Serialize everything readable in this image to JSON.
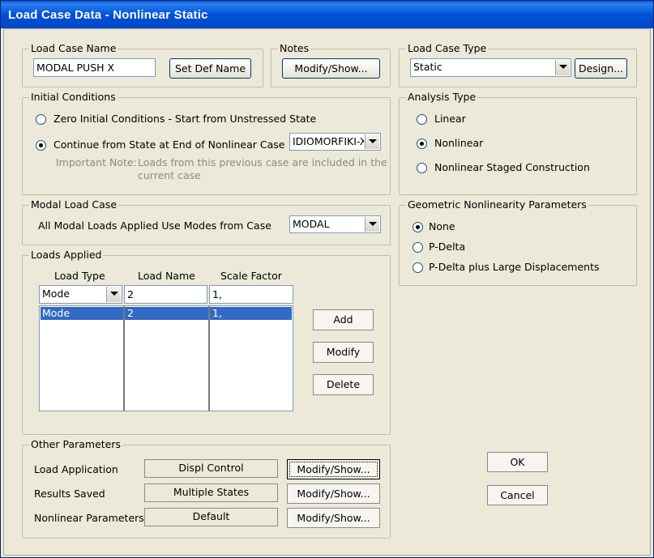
{
  "window": {
    "title": "Load Case Data - Nonlinear Static"
  },
  "load_case_name": {
    "legend": "Load Case Name",
    "value": "MODAL PUSH X",
    "set_def_name_label": "Set Def Name"
  },
  "notes": {
    "legend": "Notes",
    "modify_show_label": "Modify/Show..."
  },
  "load_case_type": {
    "legend": "Load Case Type",
    "selected": "Static",
    "design_label": "Design..."
  },
  "initial_conditions": {
    "legend": "Initial Conditions",
    "option_zero": "Zero Initial Conditions - Start from Unstressed State",
    "option_continue": "Continue from State at End of Nonlinear Case",
    "selected": "continue",
    "case_selected": "IDIOMORFIKI-X",
    "note_label": "Important Note:",
    "note_line1": "Loads from this previous case are included in the",
    "note_line2": "current case"
  },
  "analysis_type": {
    "legend": "Analysis Type",
    "option_linear": "Linear",
    "option_nonlinear": "Nonlinear",
    "option_staged": "Nonlinear Staged Construction",
    "selected": "nonlinear"
  },
  "modal_load_case": {
    "legend": "Modal Load Case",
    "label": "All Modal Loads Applied Use Modes from Case",
    "selected": "MODAL"
  },
  "geometric_nonlinearity": {
    "legend": "Geometric Nonlinearity Parameters",
    "option_none": "None",
    "option_pdelta": "P-Delta",
    "option_pdelta_large": "P-Delta plus Large Displacements",
    "selected": "none"
  },
  "loads_applied": {
    "legend": "Loads Applied",
    "col_load_type": "Load Type",
    "col_load_name": "Load Name",
    "col_scale_factor": "Scale Factor",
    "edit_load_type": "Mode",
    "edit_load_name": "2",
    "edit_scale_factor": "1,",
    "rows": [
      {
        "load_type": "Mode",
        "load_name": "2",
        "scale_factor": "1,"
      }
    ],
    "add_label": "Add",
    "modify_label": "Modify",
    "delete_label": "Delete"
  },
  "other_parameters": {
    "legend": "Other Parameters",
    "load_application_label": "Load Application",
    "load_application_value": "Displ Control",
    "results_saved_label": "Results Saved",
    "results_saved_value": "Multiple States",
    "nonlinear_parameters_label": "Nonlinear Parameters",
    "nonlinear_parameters_value": "Default",
    "modify_show_label": "Modify/Show..."
  },
  "dialog": {
    "ok_label": "OK",
    "cancel_label": "Cancel"
  },
  "colors": {
    "title_bar": "#0054e3",
    "selection": "#316ac5",
    "dialog_bg": "#ece9d8"
  }
}
